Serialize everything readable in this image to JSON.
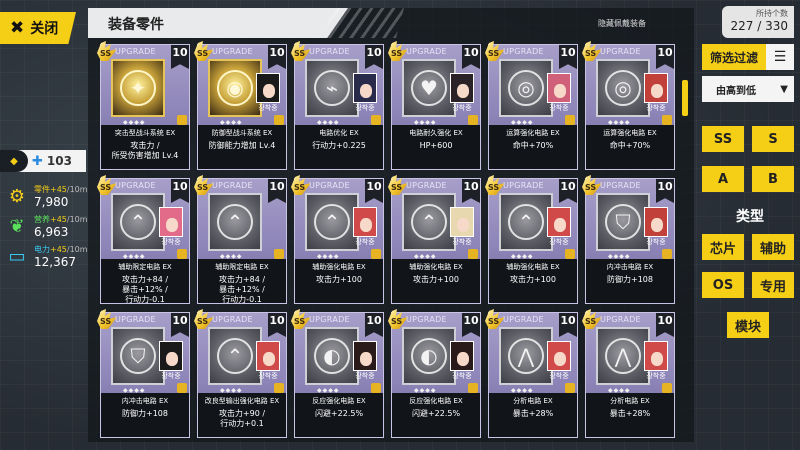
{
  "close_button": {
    "icon": "close-icon",
    "label": "关闭"
  },
  "panel_title": "装备零件",
  "hidden_equipped_label": "隐藏佩戴装备",
  "level_badge": {
    "value": "103"
  },
  "resources": [
    {
      "key": "parts",
      "name": "零件",
      "rate": "+45",
      "per": "/10m",
      "amount": "7,980",
      "color": "#f5cf16"
    },
    {
      "key": "nutri",
      "name": "营养",
      "rate": "+45",
      "per": "/10m",
      "amount": "6,963",
      "color": "#5be05b"
    },
    {
      "key": "power",
      "name": "电力",
      "rate": "+45",
      "per": "/10m",
      "amount": "12,367",
      "color": "#38c8f0"
    }
  ],
  "holding": {
    "label": "所持个数",
    "count": "227 / 330"
  },
  "filter": {
    "label": "筛选过滤",
    "menu_icon": "list-icon"
  },
  "sort": {
    "label": "由高到低",
    "icon": "chevron-down-icon"
  },
  "rank_filters": [
    "SS",
    "S",
    "A",
    "B"
  ],
  "type_label": "类型",
  "type_filters": [
    "芯片",
    "辅助",
    "OS",
    "专用",
    "模块"
  ],
  "cards": [
    {
      "upgrade": "UPGRADE",
      "level": "10",
      "gold": true,
      "emblem": "✦",
      "portrait": false,
      "equipped": "",
      "name": "突击型战斗系统 EX",
      "stat": "攻击力 /\n所受伤害增加 Lv.4",
      "hair": "#222"
    },
    {
      "upgrade": "UPGRADE",
      "level": "10",
      "gold": true,
      "emblem": "◉",
      "portrait": true,
      "equipped": "장착중",
      "name": "防御型战斗系统 EX",
      "stat": "防御能力增加 Lv.4",
      "hair": "#1a1a1a"
    },
    {
      "upgrade": "UPGRADE",
      "level": "10",
      "gold": false,
      "emblem": "⌁",
      "portrait": true,
      "equipped": "장착중",
      "name": "电路优化 EX",
      "stat": "行动力+0.225",
      "hair": "#2a2a4a"
    },
    {
      "upgrade": "UPGRADE",
      "level": "10",
      "gold": false,
      "emblem": "♥",
      "portrait": true,
      "equipped": "장착중",
      "name": "电路耐久强化 EX",
      "stat": "HP+600",
      "hair": "#2a2226"
    },
    {
      "upgrade": "UPGRADE",
      "level": "10",
      "gold": false,
      "emblem": "◎",
      "portrait": true,
      "equipped": "장착중",
      "name": "运算强化电路 EX",
      "stat": "命中+70%",
      "hair": "#d0607a"
    },
    {
      "upgrade": "UPGRADE",
      "level": "10",
      "gold": false,
      "emblem": "◎",
      "portrait": true,
      "equipped": "장착중",
      "name": "运算强化电路 EX",
      "stat": "命中+70%",
      "hair": "#c2403a"
    },
    {
      "upgrade": "UPGRADE",
      "level": "10",
      "gold": false,
      "emblem": "⌃",
      "portrait": true,
      "equipped": "장착중",
      "name": "辅助限定电路 EX",
      "stat": "攻击力+84 /\n暴击+12% /\n行动力-0.1",
      "hair": "#e36b8a"
    },
    {
      "upgrade": "UPGRADE",
      "level": "10",
      "gold": false,
      "emblem": "⌃",
      "portrait": false,
      "equipped": "",
      "name": "辅助限定电路 EX",
      "stat": "攻击力+84 /\n暴击+12% /\n行动力-0.1",
      "hair": "#333"
    },
    {
      "upgrade": "UPGRADE",
      "level": "10",
      "gold": false,
      "emblem": "⌃",
      "portrait": true,
      "equipped": "장착중",
      "name": "辅助强化电路 EX",
      "stat": "攻击力+100",
      "hair": "#d04a4a"
    },
    {
      "upgrade": "UPGRADE",
      "level": "10",
      "gold": false,
      "emblem": "⌃",
      "portrait": true,
      "equipped": "장착중",
      "name": "辅助强化电路 EX",
      "stat": "攻击力+100",
      "hair": "#e8d8b0"
    },
    {
      "upgrade": "UPGRADE",
      "level": "10",
      "gold": false,
      "emblem": "⌃",
      "portrait": true,
      "equipped": "장착중",
      "name": "辅助强化电路 EX",
      "stat": "攻击力+100",
      "hair": "#d04a4a"
    },
    {
      "upgrade": "UPGRADE",
      "level": "10",
      "gold": false,
      "emblem": "⛉",
      "portrait": true,
      "equipped": "장착중",
      "name": "内冲击电路 EX",
      "stat": "防御力+108",
      "hair": "#c2403a"
    },
    {
      "upgrade": "UPGRADE",
      "level": "10",
      "gold": false,
      "emblem": "⛉",
      "portrait": true,
      "equipped": "장착중",
      "name": "内冲击电路 EX",
      "stat": "防御力+108",
      "hair": "#1a1a1a"
    },
    {
      "upgrade": "UPGRADE",
      "level": "10",
      "gold": false,
      "emblem": "⌃",
      "portrait": true,
      "equipped": "장착중",
      "name": "改良型输出强化电路 EX",
      "stat": "攻击力+90 /\n行动力+0.1",
      "hair": "#d04a4a"
    },
    {
      "upgrade": "UPGRADE",
      "level": "10",
      "gold": false,
      "emblem": "◐",
      "portrait": true,
      "equipped": "장착중",
      "name": "反应强化电路 EX",
      "stat": "闪避+22.5%",
      "hair": "#2a1a1a"
    },
    {
      "upgrade": "UPGRADE",
      "level": "10",
      "gold": false,
      "emblem": "◐",
      "portrait": true,
      "equipped": "장착중",
      "name": "反应强化电路 EX",
      "stat": "闪避+22.5%",
      "hair": "#2a1a1a"
    },
    {
      "upgrade": "UPGRADE",
      "level": "10",
      "gold": false,
      "emblem": "⋀",
      "portrait": true,
      "equipped": "장착중",
      "name": "分析电路 EX",
      "stat": "暴击+28%",
      "hair": "#d04a4a"
    },
    {
      "upgrade": "UPGRADE",
      "level": "10",
      "gold": false,
      "emblem": "⋀",
      "portrait": true,
      "equipped": "장착중",
      "name": "分析电路 EX",
      "stat": "暴击+28%",
      "hair": "#d04a4a"
    }
  ]
}
